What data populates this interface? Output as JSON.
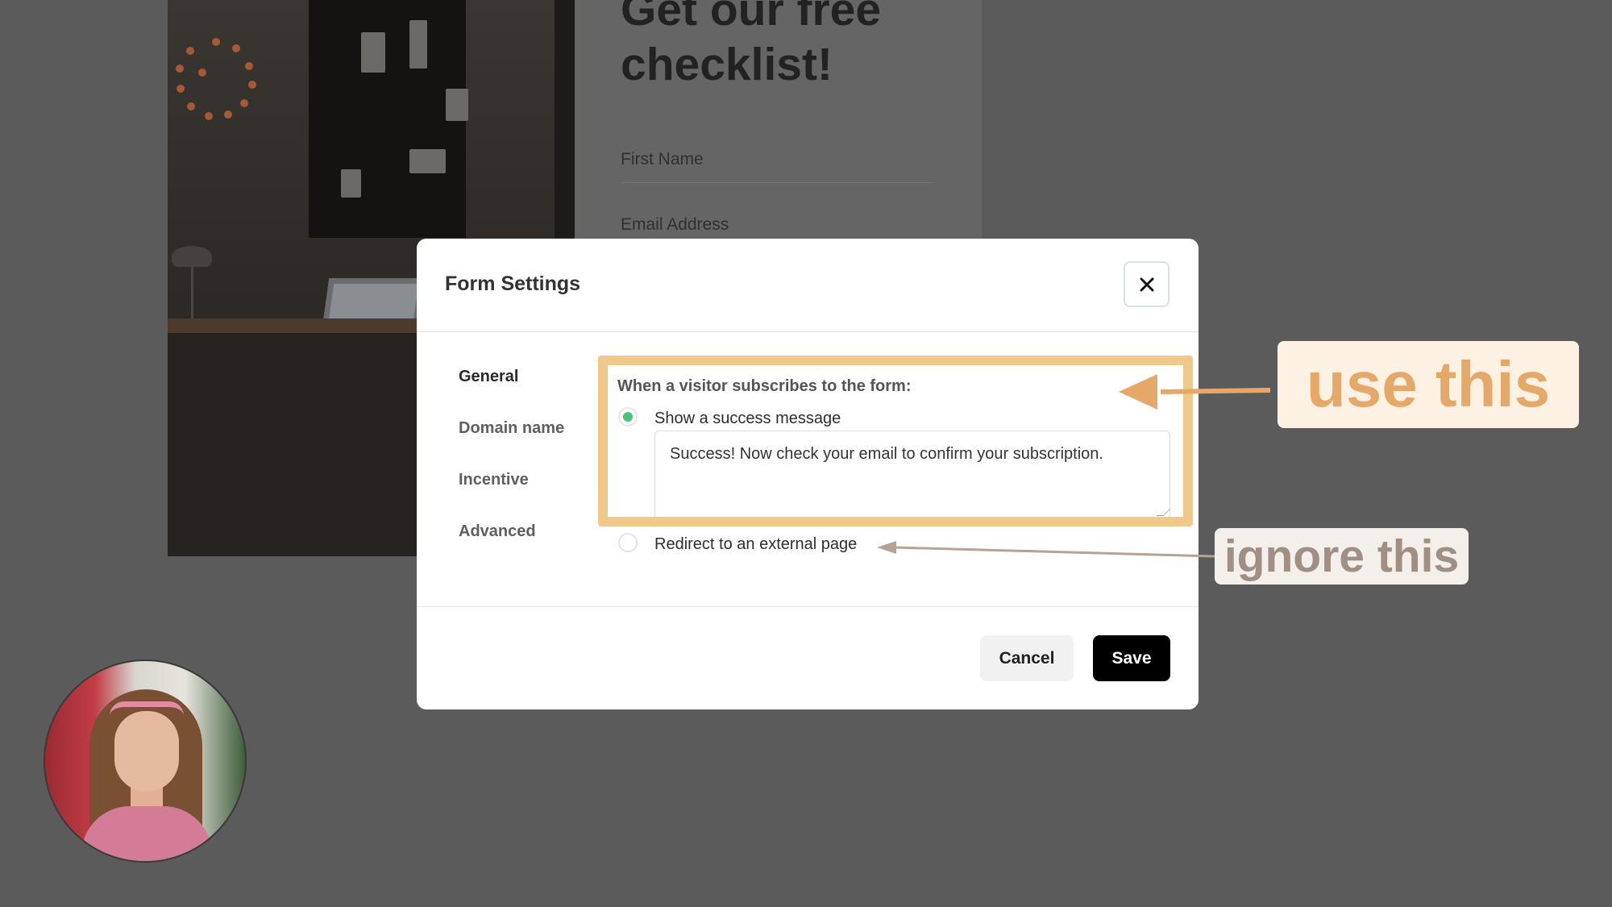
{
  "background_page": {
    "headline": "Get our free checklist!",
    "first_name_placeholder": "First Name",
    "email_placeholder": "Email Address"
  },
  "modal": {
    "title": "Form Settings",
    "close_icon": "close-icon",
    "nav": {
      "items": [
        {
          "label": "General",
          "active": true
        },
        {
          "label": "Domain name",
          "active": false
        },
        {
          "label": "Incentive",
          "active": false
        },
        {
          "label": "Advanced",
          "active": false
        }
      ]
    },
    "general": {
      "section_label": "When a visitor subscribes to the form:",
      "options": [
        {
          "label": "Show a success message",
          "selected": true
        },
        {
          "label": "Redirect to an external page",
          "selected": false
        }
      ],
      "success_message_value": "Success! Now check your email to confirm your subscription."
    },
    "footer": {
      "cancel_label": "Cancel",
      "save_label": "Save"
    }
  },
  "annotations": {
    "use_label": "use this",
    "ignore_label": "ignore this",
    "highlight_color": "#f0c98a",
    "use_color": "#e6a869",
    "ignore_color": "#a08f83"
  },
  "colors": {
    "radio_selected": "#43c57a",
    "save_button_bg": "#000000",
    "backdrop": "#5b5b5b"
  }
}
